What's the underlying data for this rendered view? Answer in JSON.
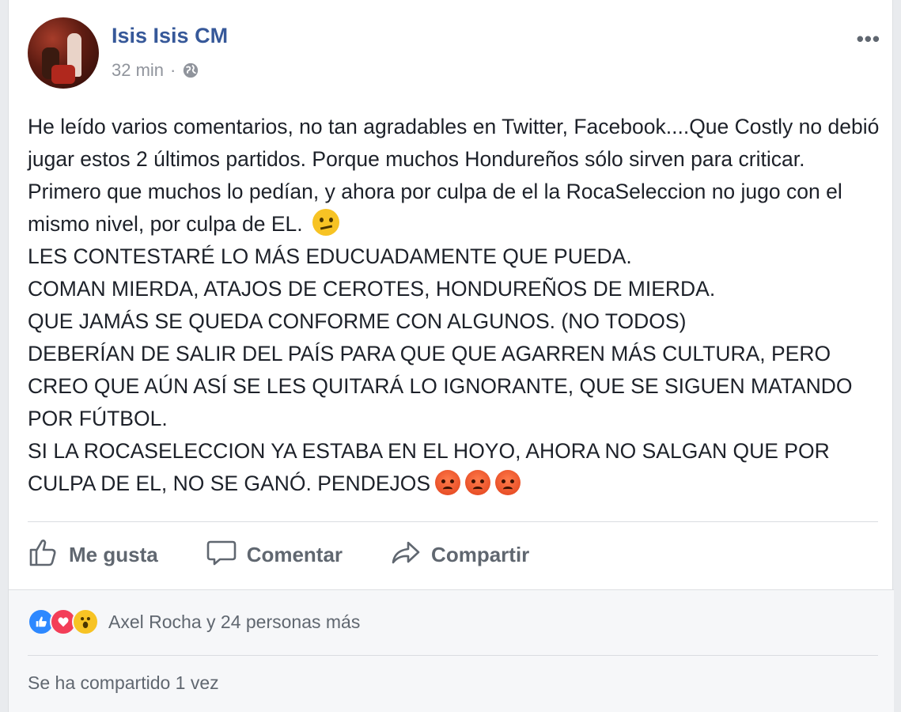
{
  "post": {
    "author": "Isis Isis CM",
    "time": "32 min",
    "separator": "·",
    "paragraphs": [
      "He leído varios comentarios, no tan agradables en Twitter, Facebook....Que Costly no debió jugar estos 2 últimos partidos. Porque muchos Hondureños sólo sirven para criticar. Primero que muchos lo pedían, y ahora por culpa de el la RocaSeleccion no jugo con el mismo nivel, por culpa de EL.",
      "LES CONTESTARÉ LO MÁS EDUCUADAMENTE QUE PUEDA.",
      "COMAN MIERDA, ATAJOS DE CEROTES, HONDUREÑOS DE MIERDA.",
      "QUE JAMÁS SE QUEDA CONFORME CON ALGUNOS. (NO TODOS)",
      "DEBERÍAN DE SALIR DEL PAÍS PARA QUE QUE AGARREN MÁS CULTURA, PERO CREO QUE AÚN ASÍ SE LES QUITARÁ LO IGNORANTE, QUE SE SIGUEN MATANDO POR FÚTBOL.",
      "SI LA ROCASELECCION YA ESTABA EN EL HOYO, AHORA NO SALGAN QUE POR CULPA DE EL, NO SE GANÓ. PENDEJOS"
    ]
  },
  "actions": {
    "like": "Me gusta",
    "comment": "Comentar",
    "share": "Compartir"
  },
  "footer": {
    "reactions_text": "Axel Rocha y 24 personas más",
    "shares_text": "Se ha compartido 1 vez"
  },
  "icons": {
    "privacy": "globe-icon",
    "menu": "more-options-icon",
    "like": "thumbs-up-icon",
    "comment": "comment-bubble-icon",
    "share": "share-arrow-icon"
  },
  "colors": {
    "author_link": "#365899",
    "meta": "#90949c",
    "action_text": "#606770",
    "like_reaction": "#2d88ff",
    "love_reaction": "#f33e58",
    "wow_reaction": "#f7c324"
  }
}
